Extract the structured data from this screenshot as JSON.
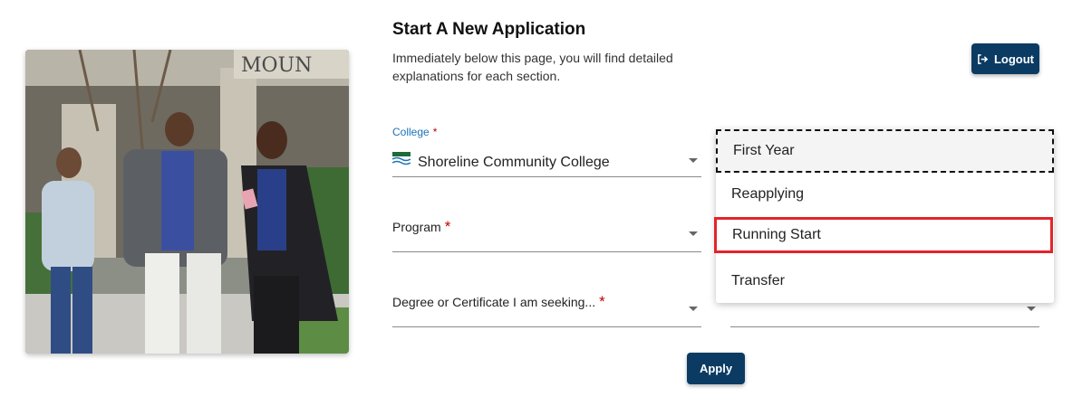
{
  "header": {
    "title": "Start A New Application",
    "subtitle": "Immediately below this page, you will find detailed explanations for each section."
  },
  "logout": {
    "label": "Logout",
    "icon": "logout-icon"
  },
  "photo": {
    "sign_text": "MOUN"
  },
  "form": {
    "college": {
      "label": "College",
      "required_mark": "*",
      "value": "Shoreline Community College",
      "logo": "shoreline-logo"
    },
    "program": {
      "label": "Program",
      "required_mark": "*",
      "value": ""
    },
    "degree": {
      "label": "Degree or Certificate I am seeking...",
      "required_mark": "*",
      "value": ""
    }
  },
  "student_type_menu": {
    "options": [
      "First Year",
      "Reapplying",
      "Running Start",
      "Transfer"
    ],
    "focused": "First Year",
    "highlighted": "Running Start"
  },
  "apply": {
    "label": "Apply"
  },
  "colors": {
    "primary": "#0b3b63",
    "label_blue": "#1a73b8",
    "required": "#c00000",
    "highlight": "#e3242b"
  }
}
